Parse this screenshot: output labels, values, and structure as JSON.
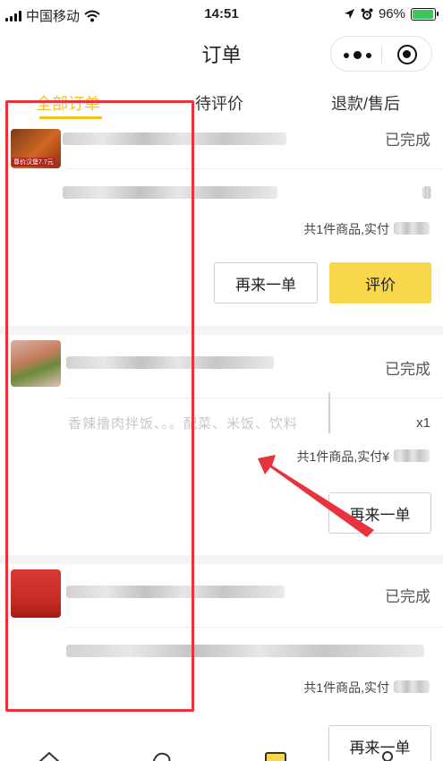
{
  "status_bar": {
    "carrier": "中国移动",
    "time": "14:51",
    "battery_percent": "96%",
    "battery_level": 0.96,
    "battery_color": "#3ac75c"
  },
  "header": {
    "title": "订单"
  },
  "tabs": [
    {
      "label": "全部订单",
      "active": true
    },
    {
      "label": "待评价",
      "active": false
    },
    {
      "label": "退款/售后",
      "active": false
    }
  ],
  "colors": {
    "accent": "#f5c223",
    "primary_button": "#f8d74a",
    "annotation_red": "#e8323c"
  },
  "orders": [
    {
      "thumb_caption": "尊价汉堡7.7元",
      "status": "已完成",
      "summary": "共1件商品,实付",
      "buttons": [
        "再来一单",
        "评价"
      ]
    },
    {
      "status": "已完成",
      "item_text": "香辣撸肉拌饭、。。配菜、米饭、饮料",
      "quantity": "x1",
      "summary": "共1件商品,实付¥",
      "buttons": [
        "再来一单"
      ]
    },
    {
      "status": "已完成",
      "summary": "共1件商品,实付",
      "buttons": [
        "再来一单"
      ]
    }
  ]
}
